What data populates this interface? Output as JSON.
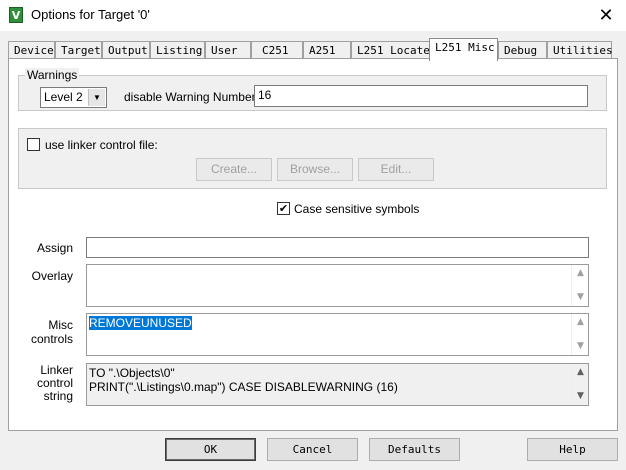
{
  "window": {
    "title": "Options for Target '0'",
    "close_glyph": "✕",
    "app_icon_letter": "V"
  },
  "tabs": [
    {
      "label": "Device"
    },
    {
      "label": "Target"
    },
    {
      "label": "Output"
    },
    {
      "label": "Listing"
    },
    {
      "label": "User"
    },
    {
      "label": "C251"
    },
    {
      "label": "A251"
    },
    {
      "label": "L251 Locate"
    },
    {
      "label": "L251 Misc",
      "active": true
    },
    {
      "label": "Debug"
    },
    {
      "label": "Utilities"
    }
  ],
  "warnings": {
    "group_label": "Warnings",
    "level_value": "Level 2",
    "disable_label": "disable Warning Numbers:",
    "disable_value": "16"
  },
  "linker_file": {
    "checkbox_label": "use linker control file:",
    "checked": false,
    "create_label": "Create...",
    "browse_label": "Browse...",
    "edit_label": "Edit..."
  },
  "case_sensitive": {
    "label": "Case sensitive symbols",
    "checked": true,
    "check_glyph": "✔"
  },
  "fields": {
    "assign_label": "Assign",
    "assign_value": "",
    "overlay_label": "Overlay",
    "overlay_value": "",
    "misc_label_line1": "Misc",
    "misc_label_line2": "controls",
    "misc_value": "REMOVEUNUSED",
    "linker_label_line1": "Linker",
    "linker_label_line2": "control",
    "linker_label_line3": "string",
    "linker_value_line1": "TO \".\\Objects\\0\"",
    "linker_value_line2": "PRINT(\".\\Listings\\0.map\") CASE DISABLEWARNING (16)"
  },
  "footer": {
    "ok_label": "OK",
    "cancel_label": "Cancel",
    "defaults_label": "Defaults",
    "help_label": "Help"
  },
  "icons": {
    "arrow_up": "▲",
    "arrow_down": "▼"
  }
}
